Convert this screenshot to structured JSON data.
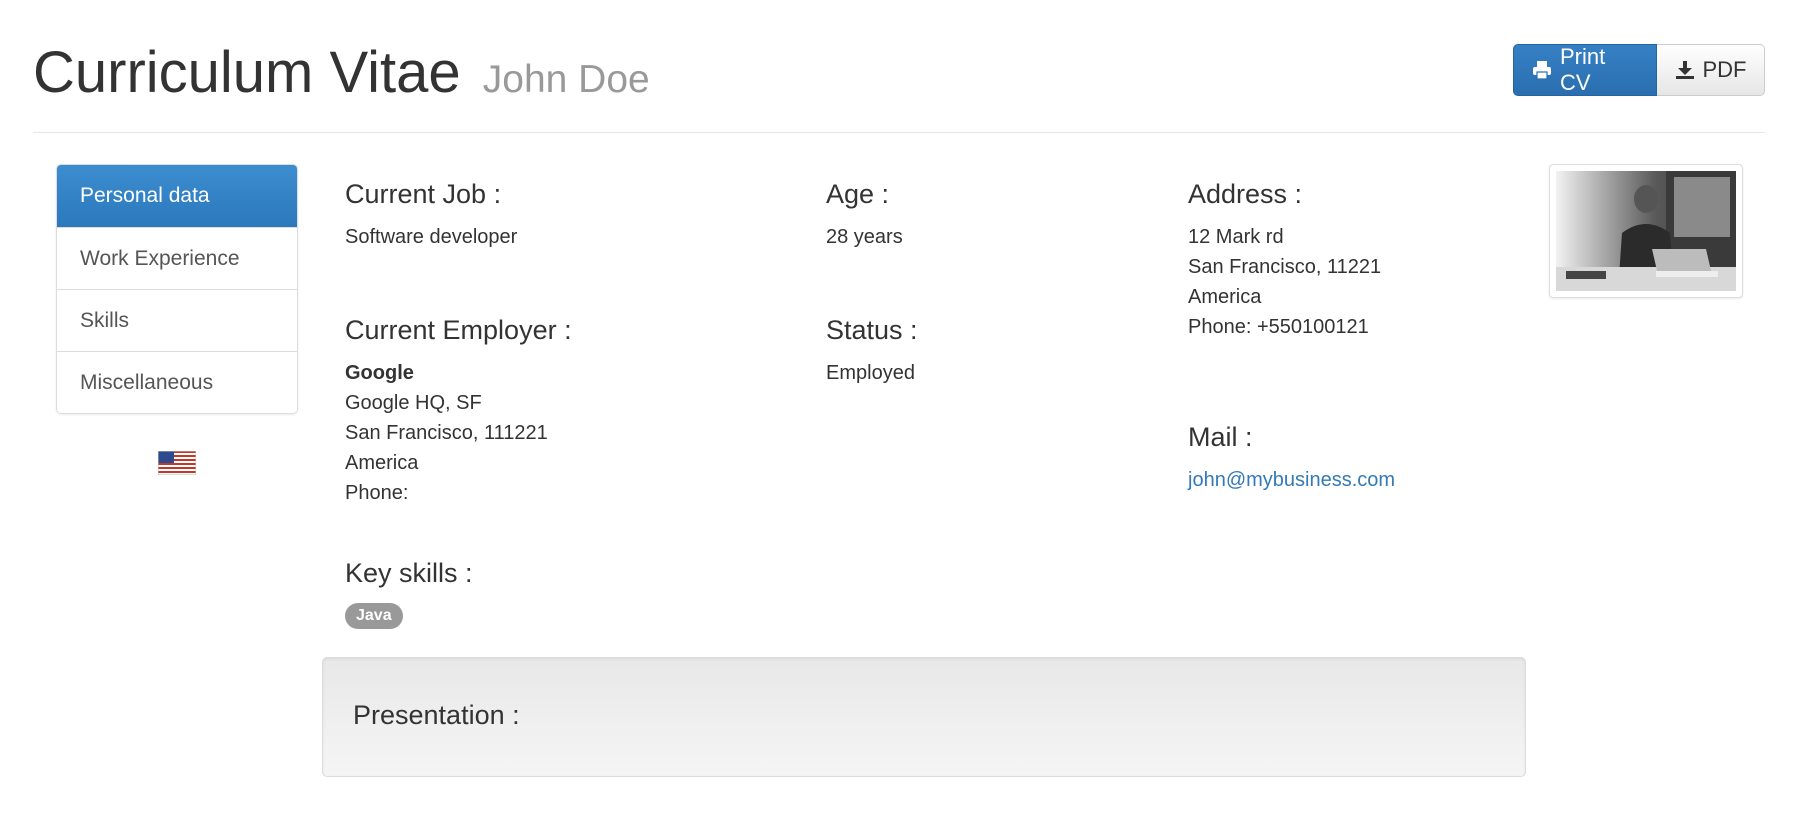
{
  "header": {
    "title": "Curriculum Vitae",
    "subtitle": "John Doe",
    "print_label": "Print CV",
    "pdf_label": "PDF"
  },
  "sidebar": {
    "items": [
      {
        "label": "Personal data",
        "active": true
      },
      {
        "label": "Work Experience",
        "active": false
      },
      {
        "label": "Skills",
        "active": false
      },
      {
        "label": "Miscellaneous",
        "active": false
      }
    ],
    "language_flag": "us-flag-icon"
  },
  "personal": {
    "current_job": {
      "label": "Current Job :",
      "value": "Software developer"
    },
    "age": {
      "label": "Age :",
      "value": "28 years"
    },
    "address": {
      "label": "Address :",
      "lines": [
        "12 Mark rd",
        "San Francisco, 11221",
        "America",
        "Phone: +550100121"
      ]
    },
    "employer": {
      "label": "Current Employer :",
      "name": "Google",
      "lines": [
        "Google HQ, SF",
        "San Francisco, 111221",
        "America",
        "Phone:"
      ]
    },
    "status": {
      "label": "Status :",
      "value": "Employed"
    },
    "mail": {
      "label": "Mail :",
      "value": "john@mybusiness.com"
    },
    "key_skills": {
      "label": "Key skills :",
      "skills": [
        "Java"
      ]
    }
  },
  "presentation": {
    "label": "Presentation :"
  },
  "colors": {
    "primary": "#337ab7",
    "badge": "#999999",
    "muted": "#999999"
  }
}
